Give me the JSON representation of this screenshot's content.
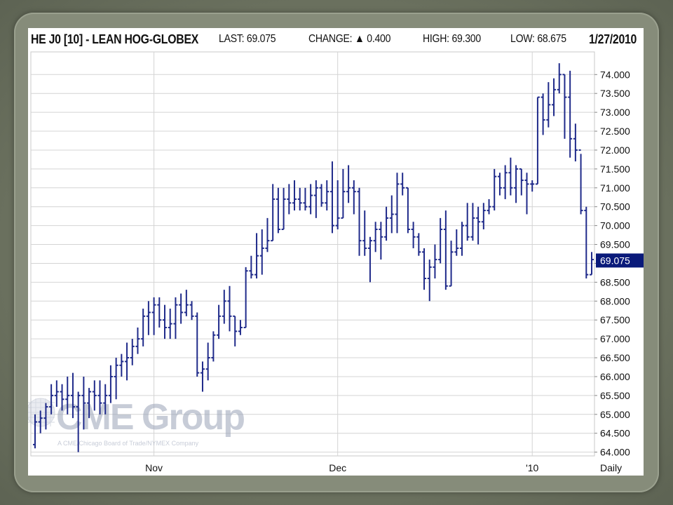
{
  "header": {
    "title": "HE J0 [10] - LEAN HOG-GLOBEX",
    "last": "LAST: 69.075",
    "change": "CHANGE: ▲ 0.400",
    "high": "HIGH: 69.300",
    "low": "LOW: 68.675",
    "date": "1/27/2010"
  },
  "watermark": {
    "brand": "CME Group",
    "sub": "A CME/Chicago Board of Trade/NYMEX Company"
  },
  "colors": {
    "bars": "#1f2a8a",
    "grid": "#d4d4d4",
    "last_price_box": "#0a1a7a"
  },
  "chart_data": {
    "type": "ohlc",
    "title": "HE J0 [10] - LEAN HOG-GLOBEX",
    "frequency": "Daily",
    "x_ticks": [
      {
        "label": "Nov",
        "index": 22
      },
      {
        "label": "Dec",
        "index": 56
      },
      {
        "label": "'10",
        "index": 92
      }
    ],
    "ylim": [
      63.9,
      74.6
    ],
    "y_ticks": [
      "74.000",
      "73.500",
      "73.000",
      "72.500",
      "72.000",
      "71.500",
      "71.000",
      "70.500",
      "70.000",
      "69.500",
      "69.000",
      "68.500",
      "68.000",
      "67.500",
      "67.000",
      "66.500",
      "66.000",
      "65.500",
      "65.000",
      "64.500",
      "64.000"
    ],
    "last_price": "69.075",
    "last_price_value": 69.075,
    "bars": [
      {
        "o": 64.2,
        "h": 65.0,
        "l": 64.1,
        "c": 64.8
      },
      {
        "o": 64.8,
        "h": 65.1,
        "l": 64.5,
        "c": 64.9
      },
      {
        "o": 64.9,
        "h": 65.3,
        "l": 64.6,
        "c": 65.2
      },
      {
        "o": 65.2,
        "h": 65.8,
        "l": 65.0,
        "c": 65.5
      },
      {
        "o": 65.5,
        "h": 65.9,
        "l": 65.2,
        "c": 65.6
      },
      {
        "o": 65.6,
        "h": 65.8,
        "l": 65.1,
        "c": 65.4
      },
      {
        "o": 65.4,
        "h": 66.0,
        "l": 65.0,
        "c": 65.5
      },
      {
        "o": 65.5,
        "h": 66.1,
        "l": 64.9,
        "c": 65.2
      },
      {
        "o": 65.2,
        "h": 65.6,
        "l": 64.0,
        "c": 65.5
      },
      {
        "o": 65.5,
        "h": 66.0,
        "l": 64.6,
        "c": 65.3
      },
      {
        "o": 65.3,
        "h": 65.7,
        "l": 64.9,
        "c": 65.6
      },
      {
        "o": 65.6,
        "h": 65.9,
        "l": 65.1,
        "c": 65.5
      },
      {
        "o": 65.5,
        "h": 65.9,
        "l": 65.0,
        "c": 65.3
      },
      {
        "o": 65.3,
        "h": 65.8,
        "l": 65.0,
        "c": 65.5
      },
      {
        "o": 65.5,
        "h": 66.3,
        "l": 65.3,
        "c": 66.0
      },
      {
        "o": 66.0,
        "h": 66.5,
        "l": 65.4,
        "c": 66.3
      },
      {
        "o": 66.3,
        "h": 66.6,
        "l": 66.0,
        "c": 66.4
      },
      {
        "o": 66.4,
        "h": 66.9,
        "l": 65.9,
        "c": 66.5
      },
      {
        "o": 66.5,
        "h": 67.0,
        "l": 66.3,
        "c": 66.8
      },
      {
        "o": 66.8,
        "h": 67.3,
        "l": 66.6,
        "c": 67.0
      },
      {
        "o": 67.0,
        "h": 67.8,
        "l": 66.8,
        "c": 67.6
      },
      {
        "o": 67.6,
        "h": 68.0,
        "l": 67.1,
        "c": 67.7
      },
      {
        "o": 67.7,
        "h": 68.1,
        "l": 67.1,
        "c": 67.9
      },
      {
        "o": 67.9,
        "h": 68.1,
        "l": 67.3,
        "c": 67.5
      },
      {
        "o": 67.5,
        "h": 67.9,
        "l": 67.0,
        "c": 67.3
      },
      {
        "o": 67.3,
        "h": 67.8,
        "l": 67.0,
        "c": 67.4
      },
      {
        "o": 67.4,
        "h": 68.1,
        "l": 67.0,
        "c": 67.9
      },
      {
        "o": 67.9,
        "h": 68.2,
        "l": 67.4,
        "c": 67.7
      },
      {
        "o": 67.7,
        "h": 68.3,
        "l": 67.6,
        "c": 67.9
      },
      {
        "o": 67.9,
        "h": 68.0,
        "l": 67.5,
        "c": 67.6
      },
      {
        "o": 67.6,
        "h": 67.7,
        "l": 66.0,
        "c": 66.1
      },
      {
        "o": 66.1,
        "h": 66.4,
        "l": 65.6,
        "c": 66.2
      },
      {
        "o": 66.2,
        "h": 66.9,
        "l": 65.9,
        "c": 66.5
      },
      {
        "o": 66.5,
        "h": 67.2,
        "l": 66.4,
        "c": 67.1
      },
      {
        "o": 67.1,
        "h": 67.9,
        "l": 67.0,
        "c": 67.6
      },
      {
        "o": 67.6,
        "h": 68.3,
        "l": 67.4,
        "c": 68.0
      },
      {
        "o": 68.0,
        "h": 68.4,
        "l": 67.2,
        "c": 67.6
      },
      {
        "o": 67.6,
        "h": 67.6,
        "l": 66.8,
        "c": 67.2
      },
      {
        "o": 67.2,
        "h": 67.5,
        "l": 67.1,
        "c": 67.3
      },
      {
        "o": 67.3,
        "h": 68.9,
        "l": 67.3,
        "c": 68.8
      },
      {
        "o": 68.8,
        "h": 69.2,
        "l": 68.6,
        "c": 68.7
      },
      {
        "o": 68.7,
        "h": 69.8,
        "l": 68.6,
        "c": 69.2
      },
      {
        "o": 69.2,
        "h": 69.9,
        "l": 68.7,
        "c": 69.4
      },
      {
        "o": 69.4,
        "h": 70.2,
        "l": 69.3,
        "c": 69.6
      },
      {
        "o": 69.6,
        "h": 71.1,
        "l": 69.6,
        "c": 70.7
      },
      {
        "o": 70.7,
        "h": 71.0,
        "l": 69.8,
        "c": 69.9
      },
      {
        "o": 69.9,
        "h": 71.0,
        "l": 69.9,
        "c": 70.7
      },
      {
        "o": 70.7,
        "h": 71.1,
        "l": 70.3,
        "c": 70.6
      },
      {
        "o": 70.6,
        "h": 71.2,
        "l": 70.4,
        "c": 70.7
      },
      {
        "o": 70.7,
        "h": 71.0,
        "l": 70.4,
        "c": 70.6
      },
      {
        "o": 70.6,
        "h": 71.0,
        "l": 70.4,
        "c": 70.5
      },
      {
        "o": 70.5,
        "h": 71.1,
        "l": 70.3,
        "c": 70.8
      },
      {
        "o": 70.8,
        "h": 71.2,
        "l": 70.2,
        "c": 71.0
      },
      {
        "o": 71.0,
        "h": 71.1,
        "l": 70.5,
        "c": 70.6
      },
      {
        "o": 70.6,
        "h": 71.2,
        "l": 70.4,
        "c": 70.9
      },
      {
        "o": 70.9,
        "h": 71.7,
        "l": 69.8,
        "c": 70.0
      },
      {
        "o": 70.0,
        "h": 71.2,
        "l": 69.9,
        "c": 70.2
      },
      {
        "o": 70.2,
        "h": 71.5,
        "l": 70.2,
        "c": 70.9
      },
      {
        "o": 70.9,
        "h": 71.6,
        "l": 70.6,
        "c": 71.0
      },
      {
        "o": 71.0,
        "h": 71.2,
        "l": 70.3,
        "c": 70.9
      },
      {
        "o": 70.9,
        "h": 71.0,
        "l": 69.2,
        "c": 69.6
      },
      {
        "o": 69.6,
        "h": 70.4,
        "l": 69.2,
        "c": 69.4
      },
      {
        "o": 69.4,
        "h": 69.7,
        "l": 68.5,
        "c": 69.6
      },
      {
        "o": 69.6,
        "h": 70.1,
        "l": 69.3,
        "c": 69.9
      },
      {
        "o": 69.9,
        "h": 70.1,
        "l": 69.1,
        "c": 69.7
      },
      {
        "o": 69.7,
        "h": 70.5,
        "l": 69.6,
        "c": 70.2
      },
      {
        "o": 70.2,
        "h": 70.8,
        "l": 69.8,
        "c": 70.3
      },
      {
        "o": 70.3,
        "h": 71.4,
        "l": 69.8,
        "c": 71.1
      },
      {
        "o": 71.1,
        "h": 71.4,
        "l": 70.8,
        "c": 71.0
      },
      {
        "o": 71.0,
        "h": 71.0,
        "l": 69.8,
        "c": 69.9
      },
      {
        "o": 69.9,
        "h": 70.1,
        "l": 69.4,
        "c": 69.7
      },
      {
        "o": 69.7,
        "h": 69.8,
        "l": 69.2,
        "c": 69.3
      },
      {
        "o": 69.3,
        "h": 69.4,
        "l": 68.3,
        "c": 68.6
      },
      {
        "o": 68.6,
        "h": 69.1,
        "l": 68.0,
        "c": 68.9
      },
      {
        "o": 68.9,
        "h": 69.5,
        "l": 68.6,
        "c": 69.1
      },
      {
        "o": 69.1,
        "h": 70.2,
        "l": 69.0,
        "c": 69.9
      },
      {
        "o": 69.9,
        "h": 70.4,
        "l": 68.3,
        "c": 68.4
      },
      {
        "o": 68.4,
        "h": 69.6,
        "l": 68.4,
        "c": 69.3
      },
      {
        "o": 69.3,
        "h": 69.9,
        "l": 69.2,
        "c": 69.4
      },
      {
        "o": 69.4,
        "h": 70.1,
        "l": 69.2,
        "c": 70.0
      },
      {
        "o": 70.0,
        "h": 70.6,
        "l": 69.6,
        "c": 69.7
      },
      {
        "o": 69.7,
        "h": 70.6,
        "l": 69.6,
        "c": 70.2
      },
      {
        "o": 70.2,
        "h": 70.5,
        "l": 69.5,
        "c": 70.1
      },
      {
        "o": 70.1,
        "h": 70.6,
        "l": 69.9,
        "c": 70.4
      },
      {
        "o": 70.4,
        "h": 70.7,
        "l": 70.3,
        "c": 70.5
      },
      {
        "o": 70.5,
        "h": 71.5,
        "l": 70.4,
        "c": 71.3
      },
      {
        "o": 71.3,
        "h": 71.4,
        "l": 70.8,
        "c": 71.0
      },
      {
        "o": 71.0,
        "h": 71.6,
        "l": 70.7,
        "c": 71.4
      },
      {
        "o": 71.4,
        "h": 71.8,
        "l": 70.8,
        "c": 71.0
      },
      {
        "o": 71.0,
        "h": 71.6,
        "l": 70.6,
        "c": 71.5
      },
      {
        "o": 71.5,
        "h": 71.5,
        "l": 70.8,
        "c": 71.2
      },
      {
        "o": 71.2,
        "h": 71.4,
        "l": 70.3,
        "c": 71.1
      },
      {
        "o": 71.1,
        "h": 71.2,
        "l": 70.9,
        "c": 71.1
      },
      {
        "o": 71.1,
        "h": 73.4,
        "l": 71.1,
        "c": 73.4
      },
      {
        "o": 73.4,
        "h": 73.5,
        "l": 72.4,
        "c": 72.8
      },
      {
        "o": 72.8,
        "h": 73.8,
        "l": 72.6,
        "c": 73.2
      },
      {
        "o": 73.2,
        "h": 73.9,
        "l": 72.9,
        "c": 73.6
      },
      {
        "o": 73.6,
        "h": 74.3,
        "l": 73.5,
        "c": 74.0
      },
      {
        "o": 74.0,
        "h": 74.0,
        "l": 72.3,
        "c": 73.4
      },
      {
        "o": 73.4,
        "h": 74.1,
        "l": 71.8,
        "c": 72.3
      },
      {
        "o": 72.3,
        "h": 72.7,
        "l": 71.7,
        "c": 72.0
      },
      {
        "o": 72.0,
        "h": 71.9,
        "l": 70.3,
        "c": 70.4
      },
      {
        "o": 70.4,
        "h": 70.5,
        "l": 68.6,
        "c": 68.7
      },
      {
        "o": 68.7,
        "h": 69.3,
        "l": 68.7,
        "c": 69.1
      }
    ]
  }
}
